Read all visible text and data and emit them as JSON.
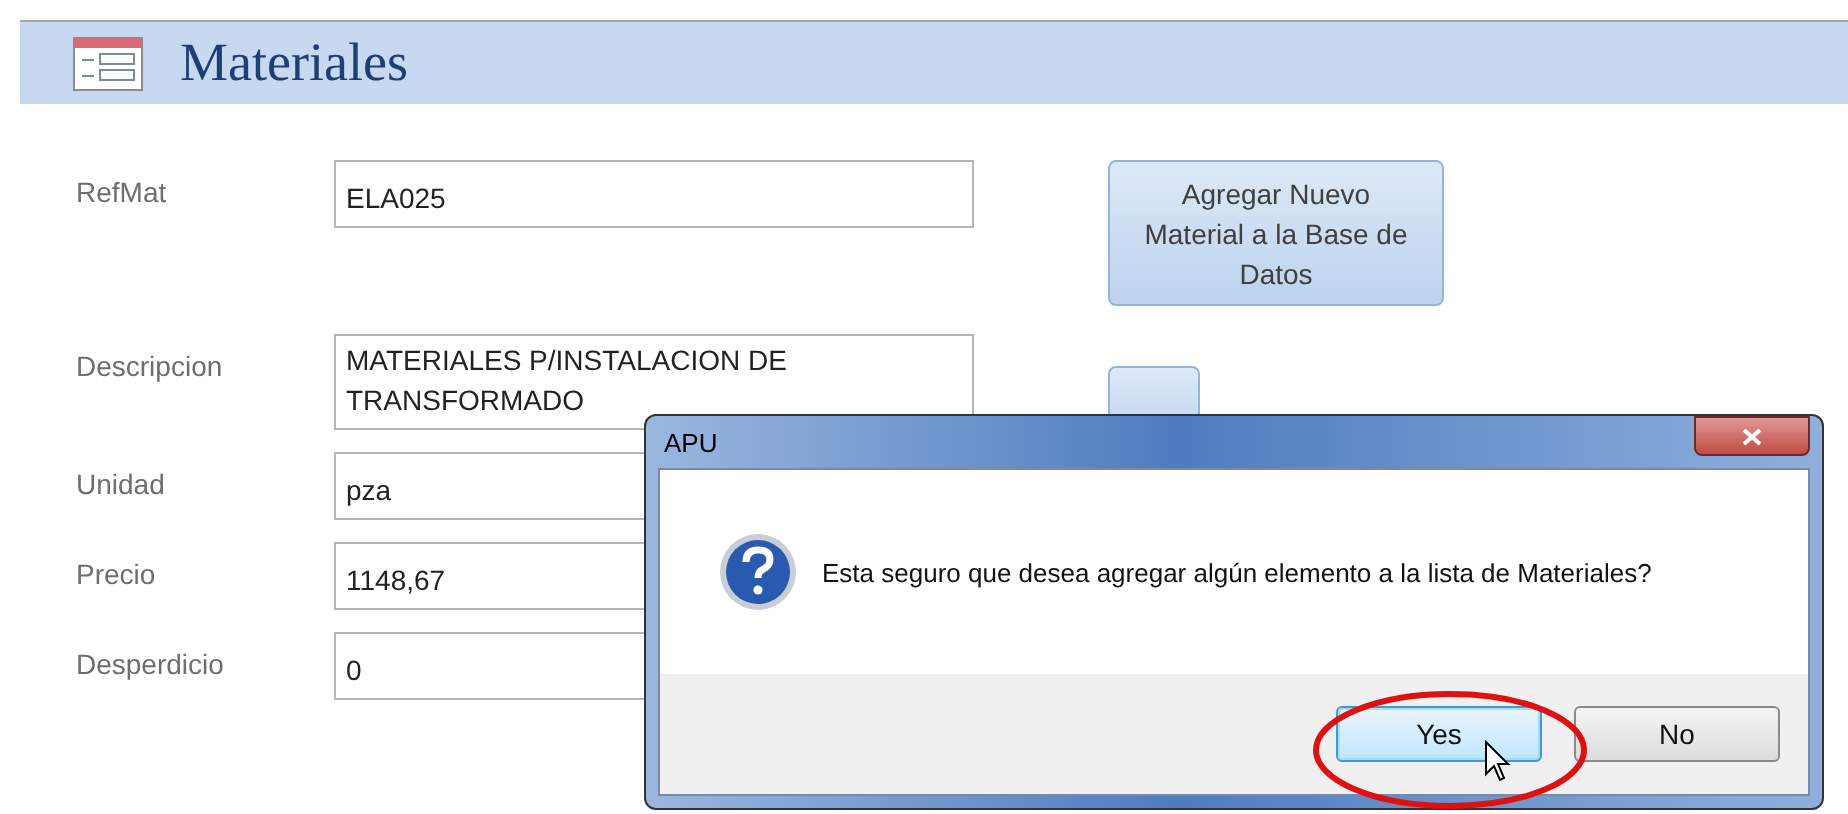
{
  "header": {
    "title": "Materiales"
  },
  "fields": [
    {
      "label": "RefMat",
      "value": "ELA025"
    },
    {
      "label": "Descripcion",
      "value": "MATERIALES P/INSTALACION DE TRANSFORMADO"
    },
    {
      "label": "Unidad",
      "value": "pza"
    },
    {
      "label": "Precio",
      "value": "1148,67"
    },
    {
      "label": "Desperdicio",
      "value": "0"
    }
  ],
  "add_button": {
    "label": "Agregar Nuevo Material a la Base de Datos"
  },
  "dialog": {
    "title": "APU",
    "message": "Esta seguro que desea agregar algún elemento a la lista de Materiales?",
    "buttons": [
      {
        "label": "Yes",
        "selected": true
      },
      {
        "label": "No",
        "selected": false
      }
    ]
  }
}
